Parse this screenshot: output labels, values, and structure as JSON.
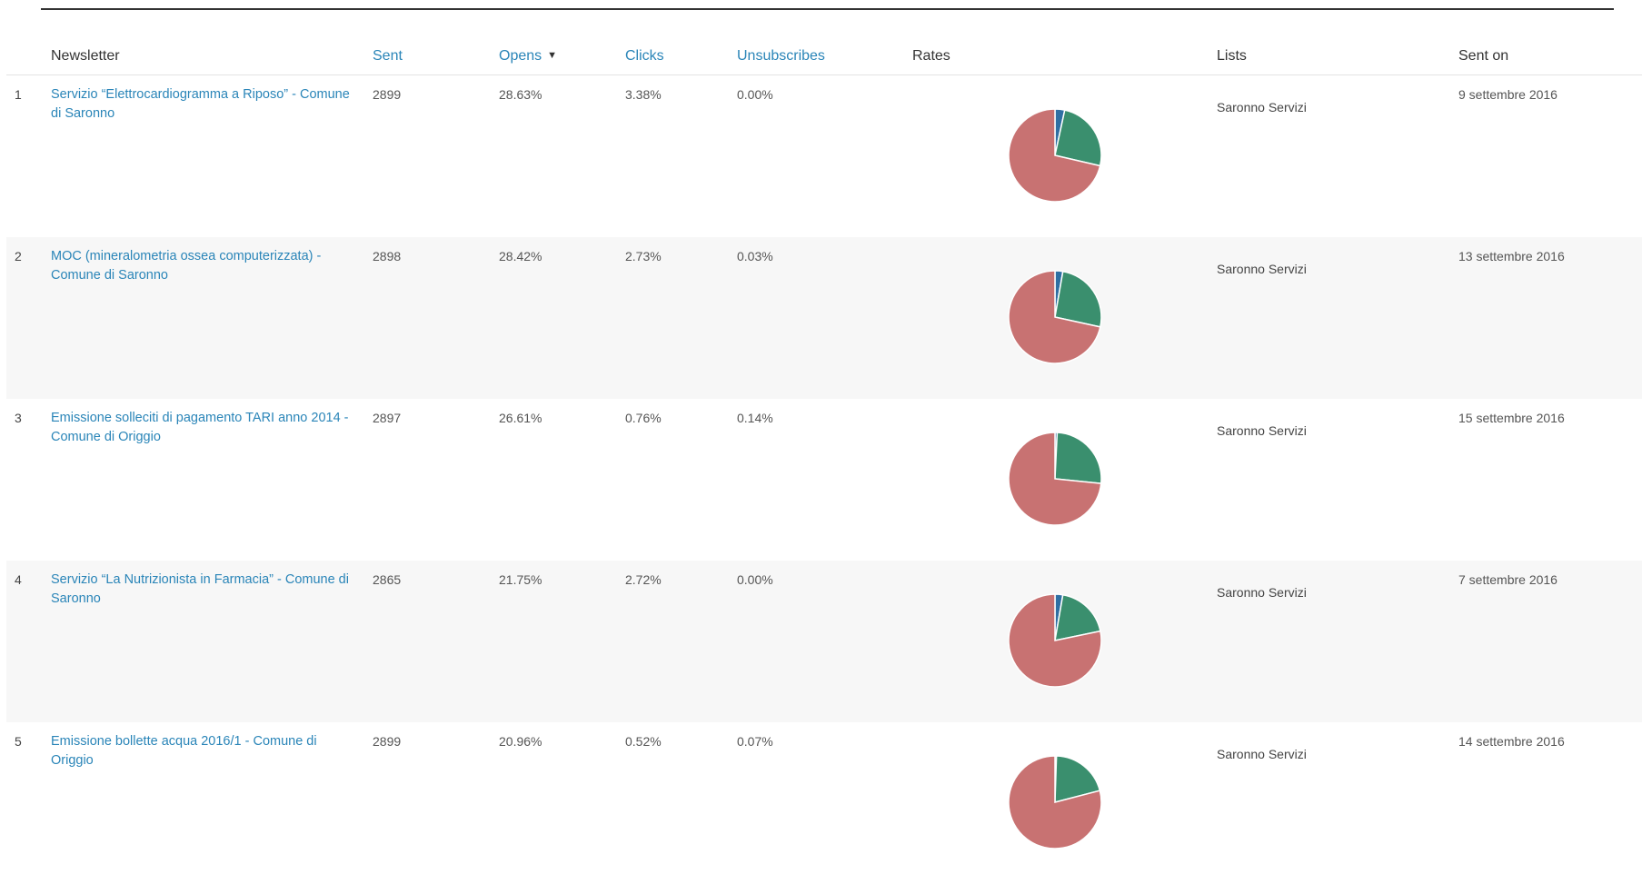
{
  "colors": {
    "link": "#2a85b8",
    "pie_opens": "#3a8f6e",
    "pie_clicks": "#2f6fa3",
    "pie_rest": "#c87272",
    "row_alt_bg": "#f7f7f7"
  },
  "header": {
    "newsletter": "Newsletter",
    "sent": "Sent",
    "opens": "Opens",
    "clicks": "Clicks",
    "unsubscribes": "Unsubscribes",
    "rates": "Rates",
    "lists": "Lists",
    "sent_on": "Sent on",
    "sort_indicator": "▼"
  },
  "rows": [
    {
      "num": "1",
      "title": "Servizio “Elettrocardiogramma a Riposo” - Comune di Saronno",
      "sent": "2899",
      "opens": "28.63%",
      "clicks": "3.38%",
      "unsubscribes": "0.00%",
      "list": "Saronno Servizi",
      "sent_on": "9 settembre 2016"
    },
    {
      "num": "2",
      "title": "MOC (mineralometria ossea computerizzata) - Comune di Saronno",
      "sent": "2898",
      "opens": "28.42%",
      "clicks": "2.73%",
      "unsubscribes": "0.03%",
      "list": "Saronno Servizi",
      "sent_on": "13 settembre 2016"
    },
    {
      "num": "3",
      "title": "Emissione solleciti di pagamento TARI anno 2014 - Comune di Origgio",
      "sent": "2897",
      "opens": "26.61%",
      "clicks": "0.76%",
      "unsubscribes": "0.14%",
      "list": "Saronno Servizi",
      "sent_on": "15 settembre 2016"
    },
    {
      "num": "4",
      "title": "Servizio “La Nutrizionista in Farmacia” - Comune di Saronno",
      "sent": "2865",
      "opens": "21.75%",
      "clicks": "2.72%",
      "unsubscribes": "0.00%",
      "list": "Saronno Servizi",
      "sent_on": "7 settembre 2016"
    },
    {
      "num": "5",
      "title": "Emissione bollette acqua 2016/1 - Comune di Origgio",
      "sent": "2899",
      "opens": "20.96%",
      "clicks": "0.52%",
      "unsubscribes": "0.07%",
      "list": "Saronno Servizi",
      "sent_on": "14 settembre 2016"
    }
  ],
  "chart_data": {
    "type": "pie",
    "charts": [
      {
        "values": [
          3.38,
          25.25,
          71.37
        ]
      },
      {
        "values": [
          2.73,
          25.69,
          71.58
        ]
      },
      {
        "values": [
          0.76,
          25.85,
          73.39
        ]
      },
      {
        "values": [
          2.72,
          19.03,
          78.25
        ]
      },
      {
        "values": [
          0.52,
          20.44,
          79.04
        ]
      }
    ]
  }
}
